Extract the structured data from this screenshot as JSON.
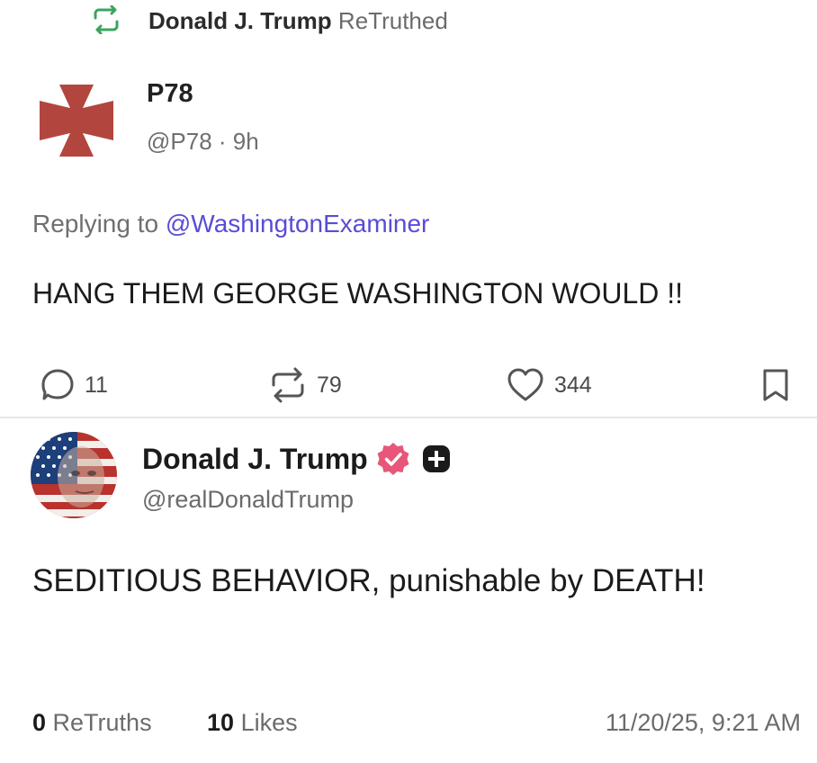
{
  "retruth_header": {
    "icon": "retruth-icon",
    "user": "Donald J. Trump",
    "action_label": "ReTruthed"
  },
  "original_post": {
    "avatar_icon": "cross-pattee-icon",
    "display_name": "P78",
    "handle": "@P78",
    "separator": " · ",
    "time": "9h",
    "replying_prefix": "Replying to ",
    "replying_to": "@WashingtonExaminer",
    "text": "HANG THEM GEORGE WASHINGTON WOULD !!",
    "actions": {
      "replies": "11",
      "retruths": "79",
      "likes": "344"
    }
  },
  "quote_post": {
    "display_name": "Donald J. Trump",
    "handle": "@realDonaldTrump",
    "verified_icon": "verified-badge-icon",
    "plus_icon": "plus-badge-icon",
    "text": "SEDITIOUS BEHAVIOR, punishable by DEATH!",
    "retruths_count": "0",
    "retruths_label": "ReTruths",
    "likes_count": "10",
    "likes_label": "Likes",
    "timestamp": "11/20/25, 9:21 AM"
  },
  "colors": {
    "retruth_green": "#3aa55d",
    "link_purple": "#5a4bd6",
    "cross_red": "#b3453f",
    "verified_pink": "#e8577a"
  }
}
